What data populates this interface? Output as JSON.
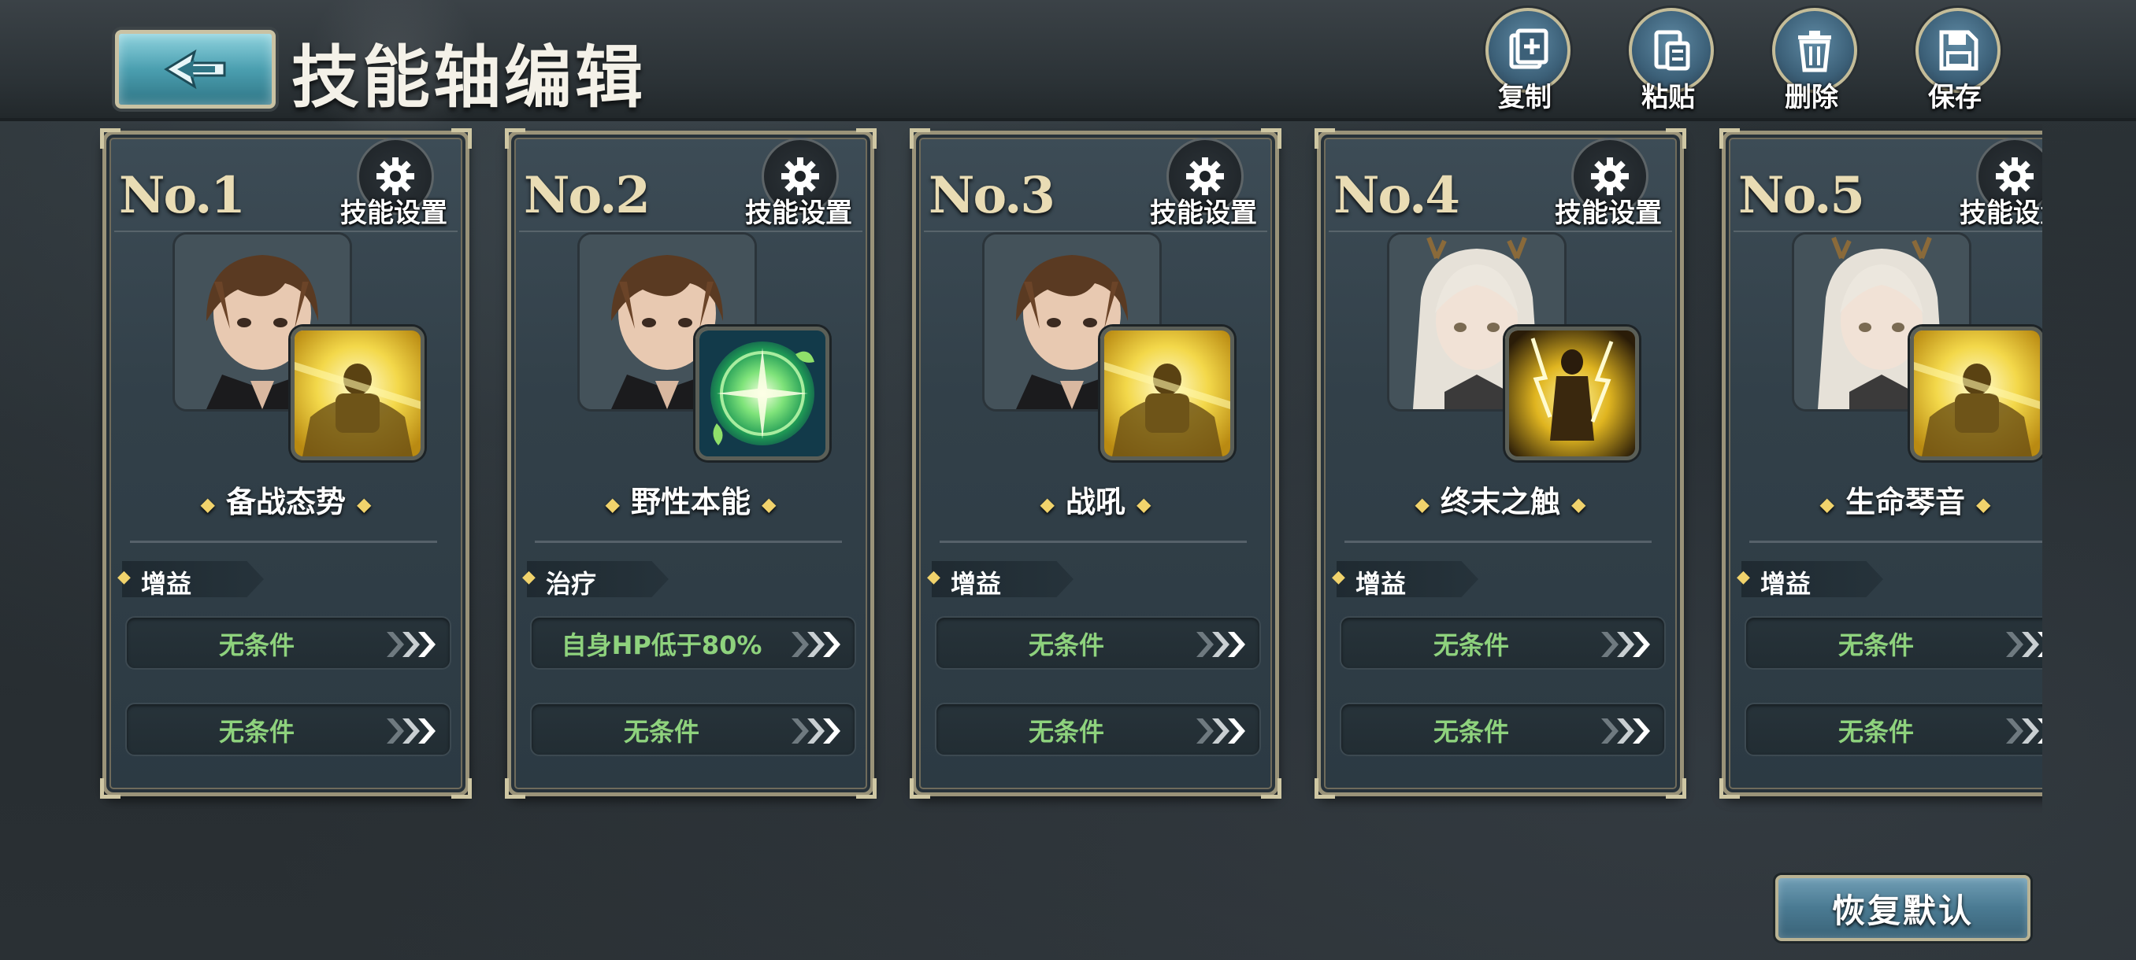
{
  "header": {
    "title": "技能轴编辑",
    "back_icon": "back-arrow-icon",
    "actions": [
      {
        "id": "copy",
        "label": "复制",
        "icon": "copy-icon"
      },
      {
        "id": "paste",
        "label": "粘贴",
        "icon": "paste-icon"
      },
      {
        "id": "delete",
        "label": "删除",
        "icon": "trash-icon"
      },
      {
        "id": "save",
        "label": "保存",
        "icon": "save-icon"
      }
    ]
  },
  "cards": [
    {
      "no": "No.1",
      "settings_label": "技能设置",
      "character": "brown-hair-hero",
      "skill_icon": "golden-guard-icon",
      "skill_name": "备战态势",
      "tag": "增益",
      "conditions": [
        "无条件",
        "无条件"
      ]
    },
    {
      "no": "No.2",
      "settings_label": "技能设置",
      "character": "brown-hair-hero",
      "skill_icon": "green-nature-orb-icon",
      "skill_name": "野性本能",
      "tag": "治疗",
      "conditions": [
        "自身HP低于80%",
        "无条件"
      ]
    },
    {
      "no": "No.3",
      "settings_label": "技能设置",
      "character": "brown-hair-hero",
      "skill_icon": "golden-guard-icon",
      "skill_name": "战吼",
      "tag": "增益",
      "conditions": [
        "无条件",
        "无条件"
      ]
    },
    {
      "no": "No.4",
      "settings_label": "技能设置",
      "character": "white-hair-antler-girl",
      "skill_icon": "golden-lightning-figure-icon",
      "skill_name": "终末之触",
      "tag": "增益",
      "conditions": [
        "无条件",
        "无条件"
      ]
    },
    {
      "no": "No.5",
      "settings_label": "技能设置",
      "character": "white-hair-antler-girl",
      "skill_icon": "golden-guard-icon",
      "skill_name": "生命琴音",
      "tag": "增益",
      "conditions": [
        "无条件",
        "无条件"
      ]
    }
  ],
  "footer": {
    "restore_label": "恢复默认"
  },
  "colors": {
    "condition_text": "#8ed27d",
    "accent_gold": "#f1d36c",
    "button_blue": "#4a7a92"
  }
}
